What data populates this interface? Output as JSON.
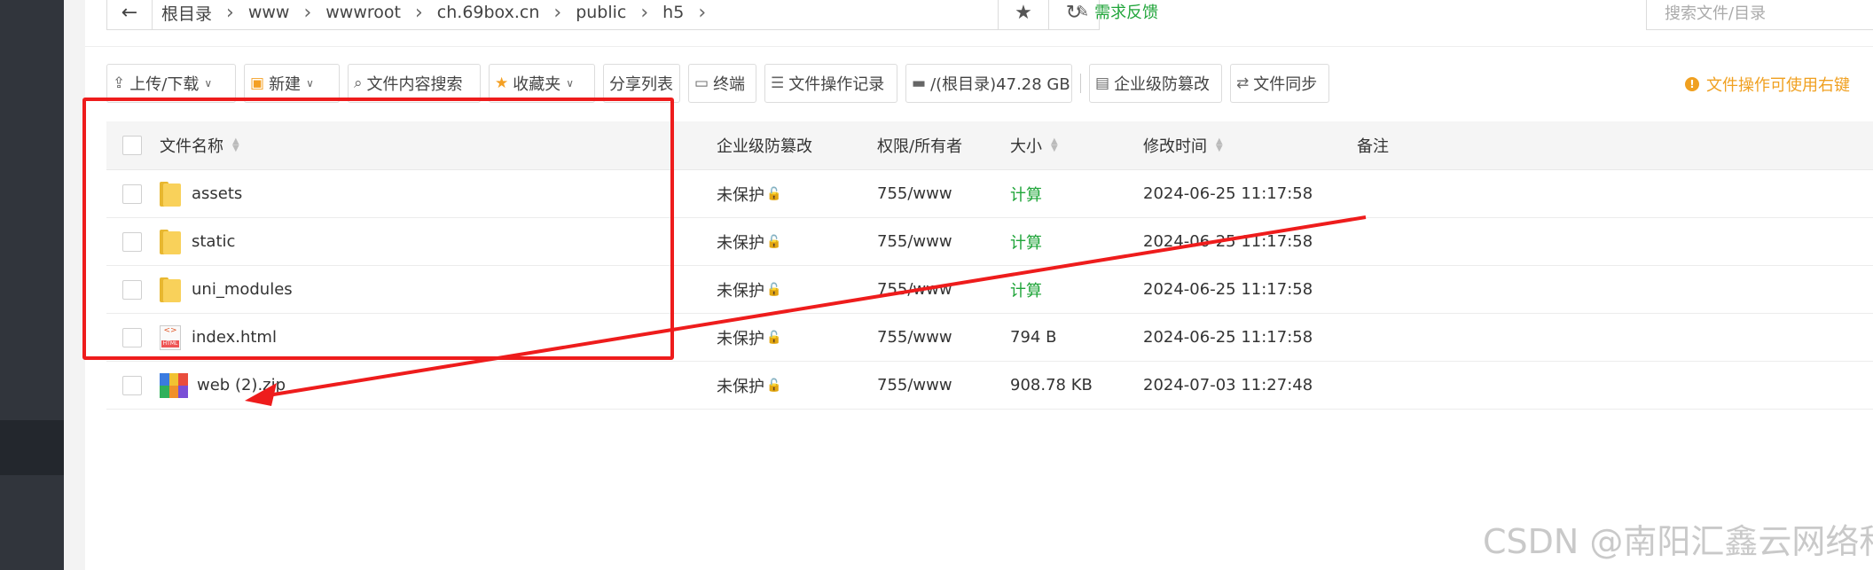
{
  "breadcrumb": {
    "items": [
      "根目录",
      "www",
      "wwwroot",
      "ch.69box.cn",
      "public",
      "h5"
    ]
  },
  "feedback_label": "需求反馈",
  "search": {
    "placeholder": "搜索文件/目录"
  },
  "toolbar": {
    "upload_download": "上传/下载",
    "new": "新建",
    "content_search": "文件内容搜索",
    "favorites": "收藏夹",
    "share_list": "分享列表",
    "terminal": "终端",
    "operation_log": "文件操作记录",
    "disk": "/(根目录)47.28 GB",
    "tamper_proof": "企业级防篡改",
    "file_sync": "文件同步"
  },
  "tip": "文件操作可使用右键",
  "table": {
    "headers": {
      "name": "文件名称",
      "protection": "企业级防篡改",
      "permission": "权限/所有者",
      "size": "大小",
      "modified": "修改时间",
      "note": "备注"
    },
    "rows": [
      {
        "type": "folder",
        "name": "assets",
        "protection": "未保护",
        "permission": "755/www",
        "size": "计算",
        "modified": "2024-06-25 11:17:58"
      },
      {
        "type": "folder",
        "name": "static",
        "protection": "未保护",
        "permission": "755/www",
        "size": "计算",
        "modified": "2024-06-25 11:17:58"
      },
      {
        "type": "folder",
        "name": "uni_modules",
        "protection": "未保护",
        "permission": "755/www",
        "size": "计算",
        "modified": "2024-06-25 11:17:58"
      },
      {
        "type": "html",
        "name": "index.html",
        "protection": "未保护",
        "permission": "755/www",
        "size": "794 B",
        "modified": "2024-06-25 11:17:58"
      },
      {
        "type": "zip",
        "name": "web (2).zip",
        "protection": "未保护",
        "permission": "755/www",
        "size": "908.78 KB",
        "modified": "2024-07-03 11:27:48"
      }
    ]
  },
  "watermark": "CSDN @南阳汇鑫云网络科技",
  "colors": {
    "accent_green": "#20a53a",
    "annotation_red": "#ee1c1c",
    "tip_orange": "#f0a020",
    "sidebar": "#31353c"
  }
}
